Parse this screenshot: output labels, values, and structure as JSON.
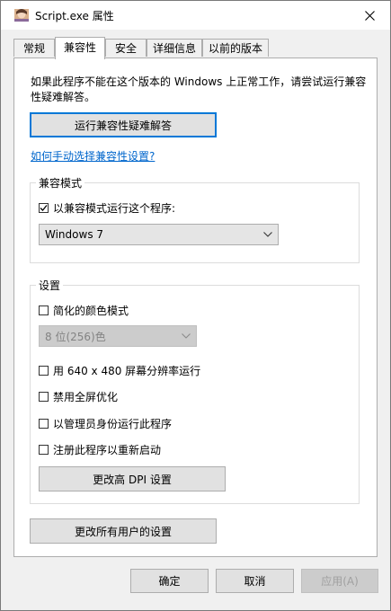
{
  "window": {
    "title": "Script.exe 属性"
  },
  "tabs": [
    {
      "label": "常规"
    },
    {
      "label": "兼容性"
    },
    {
      "label": "安全"
    },
    {
      "label": "详细信息"
    },
    {
      "label": "以前的版本"
    }
  ],
  "intro_text": "如果此程序不能在这个版本的 Windows 上正常工作，请尝试运行兼容性疑难解答。",
  "troubleshooter_button": "运行兼容性疑难解答",
  "manual_link": "如何手动选择兼容性设置?",
  "compat_mode": {
    "label": "兼容模式",
    "checkbox_label": "以兼容模式运行这个程序:",
    "checked": true,
    "selected_os": "Windows 7"
  },
  "settings": {
    "label": "设置",
    "reduced_color": {
      "label": "简化的颜色模式",
      "checked": false
    },
    "color_select": "8 位(256)色",
    "res_640": {
      "label": "用 640 x 480 屏幕分辨率运行",
      "checked": false
    },
    "disable_fullscreen": {
      "label": "禁用全屏优化",
      "checked": false
    },
    "run_admin": {
      "label": "以管理员身份运行此程序",
      "checked": false
    },
    "register_restart": {
      "label": "注册此程序以重新启动",
      "checked": false
    },
    "dpi_button": "更改高 DPI 设置"
  },
  "all_users_button": "更改所有用户的设置",
  "footer": {
    "ok": "确定",
    "cancel": "取消",
    "apply": "应用(A)"
  },
  "colors": {
    "accent": "#0078d7",
    "link": "#0066cc"
  }
}
